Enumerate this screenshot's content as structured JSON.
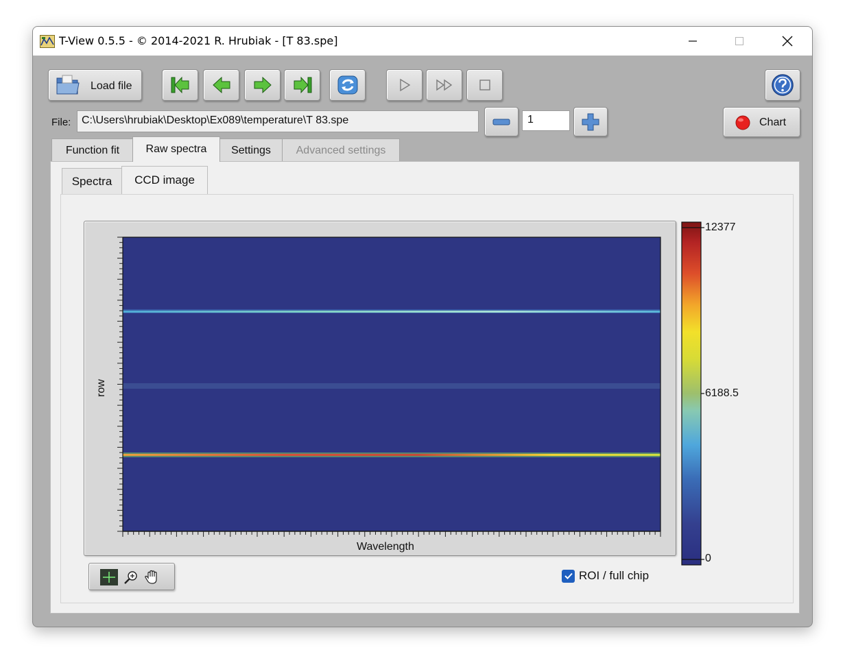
{
  "window": {
    "title": "T-View 0.5.5 - © 2014-2021 R. Hrubiak - [T  83.spe]"
  },
  "toolbar": {
    "load_file_label": "Load file",
    "chart_label": "Chart"
  },
  "file": {
    "label": "File:",
    "path": "C:\\Users\\hrubiak\\Desktop\\Ex089\\temperature\\T  83.spe",
    "frame": "1"
  },
  "tabs": [
    {
      "label": "Function fit"
    },
    {
      "label": "Raw spectra"
    },
    {
      "label": "Settings"
    },
    {
      "label": "Advanced settings"
    }
  ],
  "subtabs": [
    {
      "label": "Spectra"
    },
    {
      "label": "CCD image"
    }
  ],
  "plot": {
    "xlabel": "Wavelength",
    "ylabel": "row"
  },
  "colorbar": {
    "max_label": "12377",
    "mid_label": "6188.5",
    "min_label": "0"
  },
  "roi": {
    "label": "ROI / full chip",
    "checked": true
  },
  "colors": {
    "background_blue": "#2e3683",
    "band_color": "#3b4d92",
    "accent_red": "#e8211f"
  }
}
